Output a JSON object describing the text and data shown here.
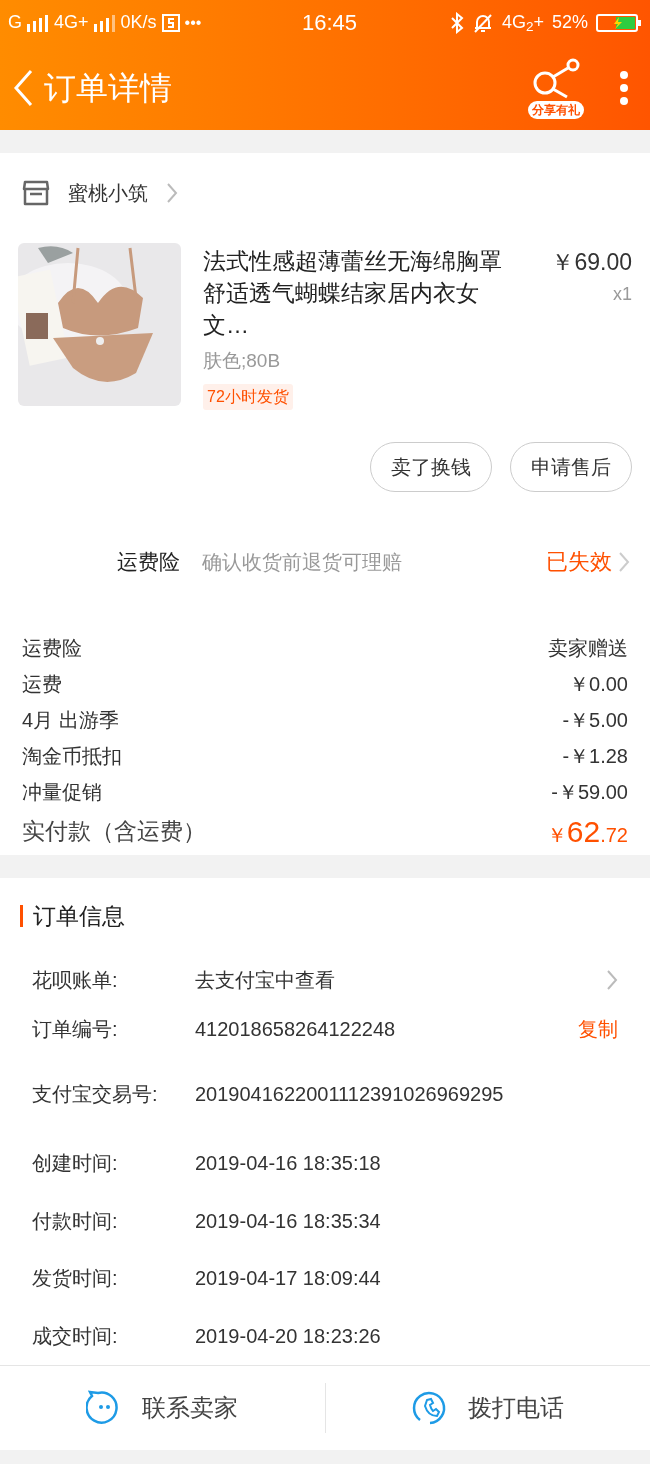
{
  "status_bar": {
    "carrier": "G",
    "network": "4G+",
    "speed": "0K/s",
    "more": "•••",
    "time": "16:45",
    "network_2": "4G$_{2}$+",
    "battery_percent": "52%",
    "charging": true
  },
  "header": {
    "title": "订单详情",
    "share_badge": "分享有礼"
  },
  "shop": {
    "name": "蜜桃小筑"
  },
  "product": {
    "title": "法式性感超薄蕾丝无海绵胸罩舒适透气蝴蝶结家居内衣女文…",
    "sku": "肤色;80B",
    "tag": "72小时发货",
    "price": "￥69.00",
    "quantity": "x1"
  },
  "actions": [
    "卖了换钱",
    "申请售后"
  ],
  "insurance": {
    "label": "运费险",
    "description": "确认收货前退货可理赔",
    "status": "已失效"
  },
  "fees": [
    {
      "label": "运费险",
      "value": "卖家赠送"
    },
    {
      "label": "运费",
      "value": "￥0.00"
    },
    {
      "label": "4月 出游季",
      "value": "-￥5.00"
    },
    {
      "label": "淘金币抵扣",
      "value": "-￥1.28"
    },
    {
      "label": "冲量促销",
      "value": "-￥59.00"
    }
  ],
  "total": {
    "label": "实付款（含运费）",
    "currency": "￥",
    "integer": "62",
    "decimal": ".72"
  },
  "order_info": {
    "title": "订单信息",
    "rows": [
      {
        "kind": "link",
        "label": "花呗账单:",
        "value": "去支付宝中查看"
      },
      {
        "kind": "copy",
        "label": "订单编号:",
        "value": "412018658264122248",
        "action": "复制"
      },
      {
        "kind": "text",
        "label": "支付宝交易号:",
        "value": "2019041622001112391026969295"
      },
      {
        "kind": "text",
        "label": "创建时间:",
        "value": "2019-04-16 18:35:18"
      },
      {
        "kind": "text",
        "label": "付款时间:",
        "value": "2019-04-16 18:35:34"
      },
      {
        "kind": "text",
        "label": "发货时间:",
        "value": "2019-04-17 18:09:44"
      },
      {
        "kind": "text",
        "label": "成交时间:",
        "value": "2019-04-20 18:23:26"
      }
    ]
  },
  "bottom_bar": [
    {
      "kind": "chat",
      "label": "联系卖家"
    },
    {
      "kind": "phone",
      "label": "拨打电话"
    }
  ]
}
